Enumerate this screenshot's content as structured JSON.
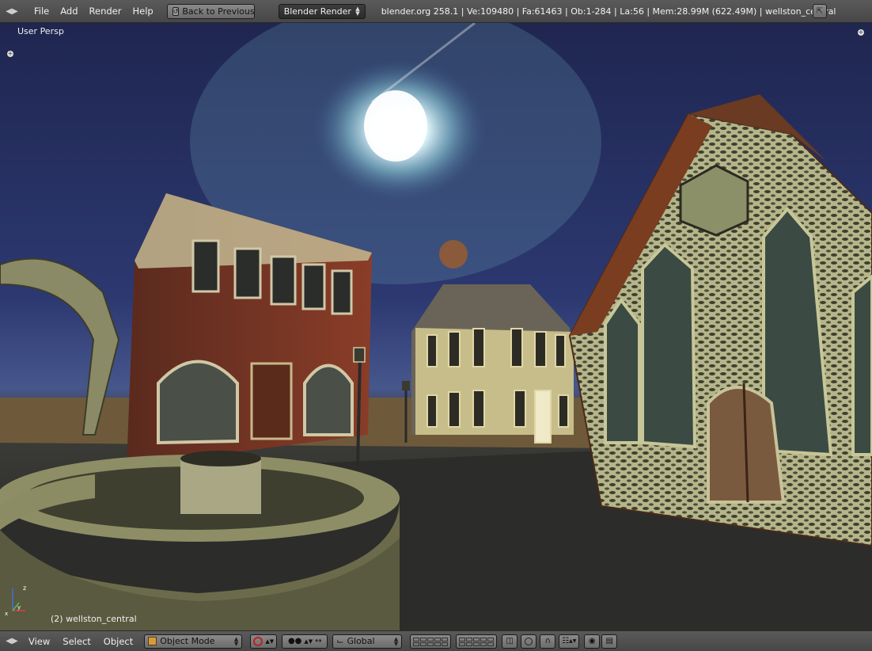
{
  "top_header": {
    "menus": [
      "File",
      "Add",
      "Render",
      "Help"
    ],
    "back_button_label": "Back to Previous",
    "render_engine": "Blender Render",
    "stats": "blender.org 258.1 | Ve:109480 | Fa:61463 | Ob:1-284 | La:56 | Mem:28.99M (622.49M) | wellston_central"
  },
  "viewport": {
    "view_name": "User Persp",
    "object_info": "(2) wellston_central"
  },
  "bottom_header": {
    "menus": [
      "View",
      "Select",
      "Object"
    ],
    "mode": "Object Mode",
    "transform_orientation": "Global"
  },
  "colors": {
    "header_bg": "#4f4f4f",
    "sky_dark": "#1f2650",
    "brick": "#7a3524",
    "stone": "#b9b98a",
    "house": "#c8bf8e"
  }
}
